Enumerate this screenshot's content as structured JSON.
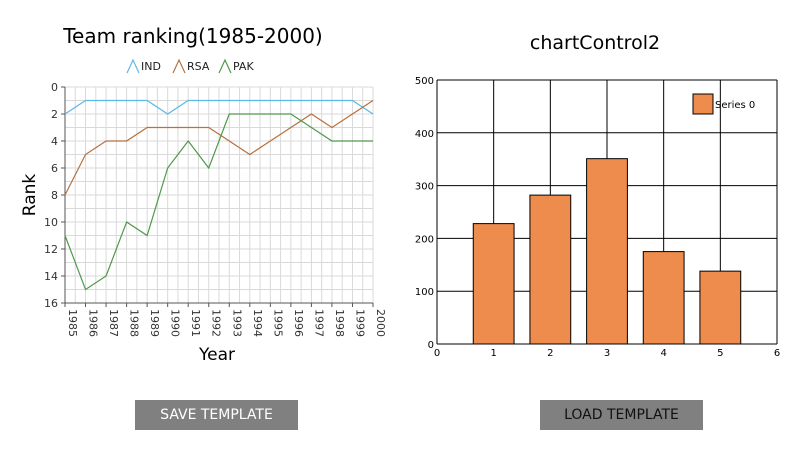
{
  "charts": {
    "left": {
      "title": "Team ranking(1985-2000)",
      "xlabel": "Year",
      "ylabel": "Rank"
    },
    "right": {
      "title": "chartControl2"
    }
  },
  "buttons": {
    "save_label": "SAVE TEMPLATE",
    "load_label": "LOAD TEMPLATE"
  },
  "colors": {
    "IND": "#5bb8e6",
    "RSA": "#b5713f",
    "PAK": "#4d9a4a",
    "bar_fill": "#ee8c4d",
    "button_bg": "#808080"
  },
  "chart_data": [
    {
      "type": "line",
      "title": "Team ranking(1985-2000)",
      "xlabel": "Year",
      "ylabel": "Rank",
      "x": [
        "1985",
        "1986",
        "1987",
        "1988",
        "1989",
        "1990",
        "1991",
        "1992",
        "1993",
        "1994",
        "1995",
        "1996",
        "1997",
        "1998",
        "1999",
        "2000"
      ],
      "yticks": [
        "0",
        "2",
        "4",
        "6",
        "8",
        "10",
        "12",
        "14",
        "16"
      ],
      "ylim": [
        0,
        16
      ],
      "y_reversed": true,
      "grid": true,
      "legend_position": "top",
      "series": [
        {
          "name": "IND",
          "values": [
            2,
            1,
            1,
            1,
            1,
            2,
            1,
            1,
            1,
            1,
            1,
            1,
            1,
            1,
            1,
            2
          ]
        },
        {
          "name": "RSA",
          "values": [
            8,
            5,
            4,
            4,
            3,
            3,
            3,
            3,
            4,
            5,
            4,
            3,
            2,
            3,
            2,
            1
          ]
        },
        {
          "name": "PAK",
          "values": [
            11,
            15,
            14,
            10,
            11,
            6,
            4,
            6,
            2,
            2,
            2,
            2,
            3,
            4,
            4,
            4
          ]
        }
      ]
    },
    {
      "type": "bar",
      "title": "chartControl2",
      "x": [
        1,
        2,
        3,
        4,
        5
      ],
      "xticks": [
        "0",
        "1",
        "2",
        "3",
        "4",
        "5",
        "6"
      ],
      "xlim": [
        0,
        6
      ],
      "yticks": [
        "0",
        "100",
        "200",
        "300",
        "400",
        "500"
      ],
      "ylim": [
        0,
        500
      ],
      "grid": true,
      "legend_position": "top-right",
      "series": [
        {
          "name": "Series 0",
          "values": [
            228,
            282,
            351,
            175,
            138
          ]
        }
      ]
    }
  ]
}
